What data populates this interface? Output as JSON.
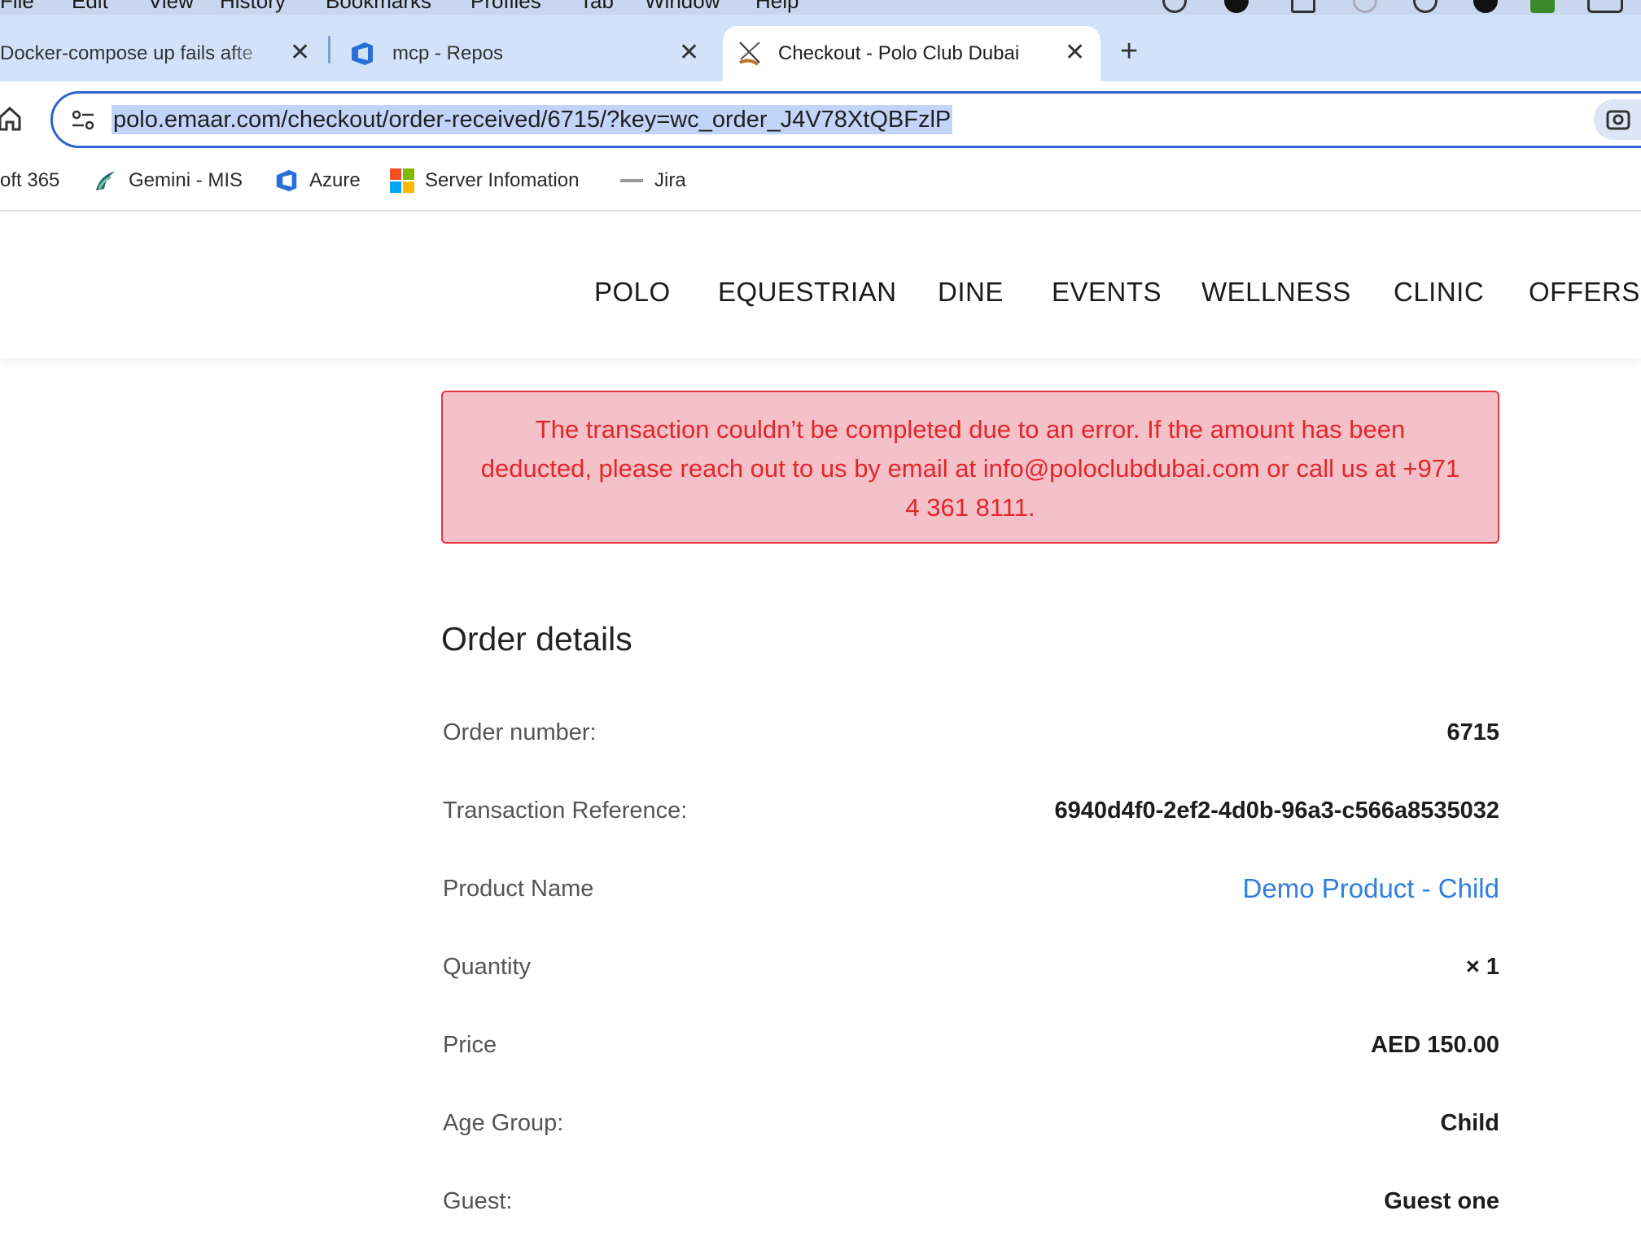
{
  "menubar": {
    "items": [
      "File",
      "Edit",
      "View",
      "History",
      "Bookmarks",
      "Profiles",
      "Tab",
      "Window",
      "Help"
    ]
  },
  "tabs": [
    {
      "title": "Docker-compose up fails afte",
      "active": false
    },
    {
      "title": "mcp - Repos",
      "active": false
    },
    {
      "title": "Checkout - Polo Club Dubai",
      "active": true
    }
  ],
  "address_bar": {
    "url": "polo.emaar.com/checkout/order-received/6715/?key=wc_order_J4V78XtQBFzlP"
  },
  "bookmarks": [
    {
      "label": "oft 365",
      "icon": "microsoft-365-icon"
    },
    {
      "label": "Gemini - MIS",
      "icon": "gemini-bird-icon"
    },
    {
      "label": "Azure",
      "icon": "azure-devops-icon"
    },
    {
      "label": "Server Infomation",
      "icon": "microsoft-logo-icon"
    },
    {
      "label": "Jira",
      "icon": "emaar-icon"
    }
  ],
  "site_nav": [
    "POLO",
    "EQUESTRIAN",
    "DINE",
    "EVENTS",
    "WELLNESS",
    "CLINIC",
    "OFFERS"
  ],
  "alert": {
    "lines": [
      "The transaction couldn’t be completed due to an error. If the amount has been",
      "deducted, please reach out to us by email at info@poloclubdubai.com or call us at +971",
      "4 361 8111."
    ]
  },
  "order": {
    "title": "Order details",
    "rows": [
      {
        "label": "Order number:",
        "value": "6715"
      },
      {
        "label": "Transaction Reference:",
        "value": "6940d4f0-2ef2-4d0b-96a3-c566a8535032"
      },
      {
        "label": "Product Name",
        "value": "Demo Product - Child"
      },
      {
        "label": "Quantity",
        "value": "× 1"
      },
      {
        "label": "Price",
        "value": "AED 150.00"
      },
      {
        "label": "Age Group:",
        "value": "Child"
      },
      {
        "label": "Guest:",
        "value": "Guest one"
      }
    ]
  },
  "colors": {
    "tabstrip": "#d3e2fb",
    "omnibox_border": "#2f63d1",
    "url_selection": "#c2d5f9",
    "alert_bg": "#f4c1c8",
    "alert_text": "#e3262c",
    "link": "#2f7fe0"
  }
}
